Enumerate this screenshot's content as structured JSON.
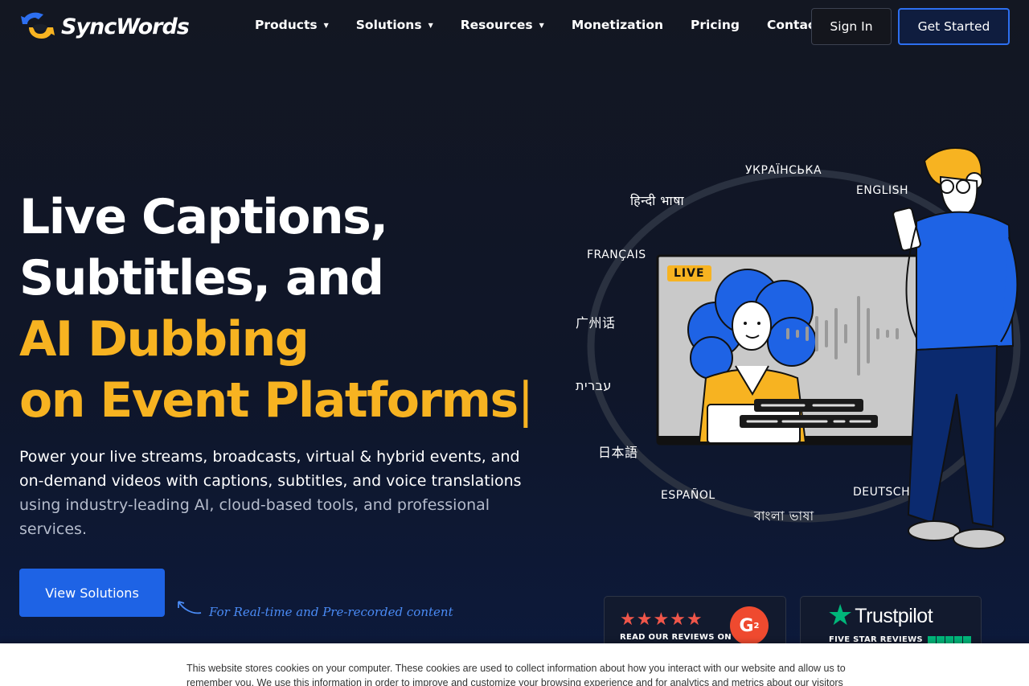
{
  "brand": {
    "name": "SyncWords"
  },
  "nav": {
    "items": [
      {
        "label": "Products",
        "caret": "▼"
      },
      {
        "label": "Solutions",
        "caret": "▼"
      },
      {
        "label": "Resources",
        "caret": "▼"
      },
      {
        "label": "Monetization"
      },
      {
        "label": "Pricing"
      },
      {
        "label": "Contact"
      }
    ],
    "sign_in": "Sign In",
    "get_started": "Get Started"
  },
  "hero": {
    "title_line1": "Live Captions,",
    "title_line2": "Subtitles, and",
    "title_line3": "AI Dubbing",
    "title_line4": "on Event Platforms",
    "cursor": "|",
    "desc_bright": "Power your live streams, broadcasts, virtual & hybrid events, and on-demand videos with captions, subtitles, and voice translations",
    "desc_dim": "using industry-leading AI, cloud-based tools, and professional services.",
    "cta": "View Solutions",
    "note": "For Real-time and Pre-recorded content"
  },
  "illustration": {
    "live_badge": "LIVE",
    "languages": [
      "УКРАЇНСЬКА",
      "ENGLISH",
      "हिन्दी भाषा",
      "FRANÇAIS",
      "广州话",
      "עברית",
      "日本語",
      "ESPAÑOL",
      "DEUTSCH",
      "বাংলা ভাষা"
    ]
  },
  "reviews": {
    "g2_stars": "★★★★★",
    "g2_label": "READ OUR REVIEWS ON",
    "g2_badge": "G",
    "tp_star": "★",
    "tp_name": "Trustpilot",
    "tp_label": "FIVE STAR REVIEWS"
  },
  "cookie": {
    "text": "This website stores cookies on your computer. These cookies are used to collect information about how you interact with our website and allow us to remember you. We use this information in order to improve and customize your browsing experience and for analytics and metrics about our visitors both"
  },
  "colors": {
    "accent_yellow": "#f7b321",
    "primary_blue": "#1e63e5",
    "background": "#131722",
    "g2_red": "#ef4a2f",
    "trustpilot_green": "#00b67a"
  }
}
